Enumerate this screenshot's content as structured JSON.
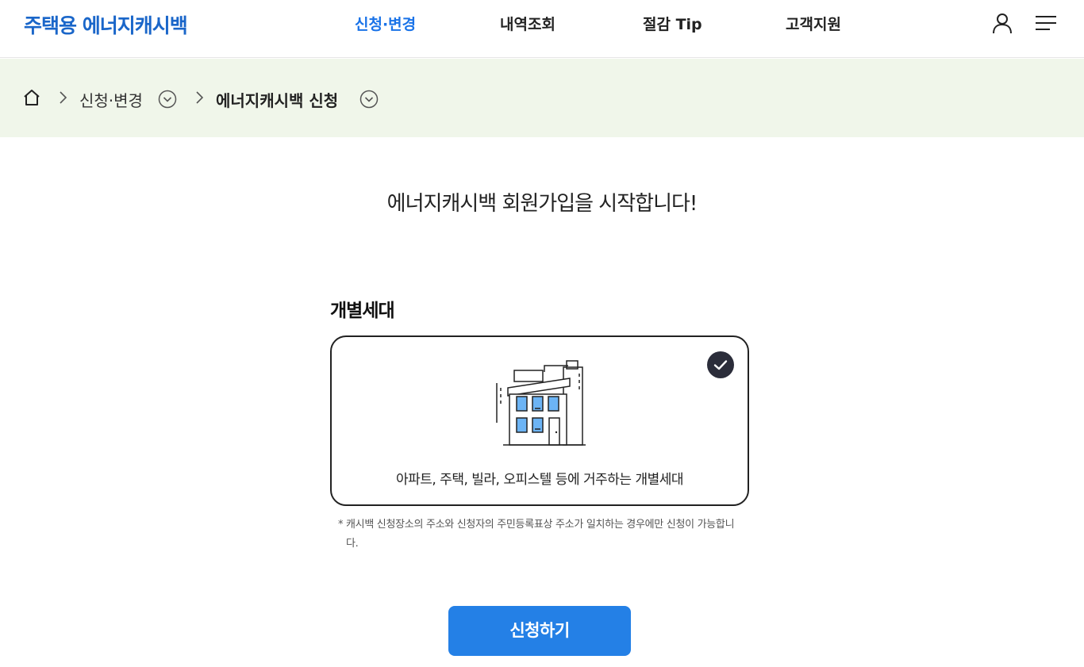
{
  "header": {
    "logo": "주택용 에너지캐시백",
    "nav": [
      {
        "label": "신청·변경",
        "active": true
      },
      {
        "label": "내역조회",
        "active": false
      },
      {
        "label": "절감 Tip",
        "active": false
      },
      {
        "label": "고객지원",
        "active": false
      }
    ],
    "icons": {
      "user": "user-icon",
      "menu": "hamburger-menu-icon"
    },
    "accent_color": "#1a73e8",
    "logo_color": "#1a66c9"
  },
  "breadcrumb": {
    "home_icon": "home-icon",
    "items": [
      {
        "label": "신청·변경"
      },
      {
        "label": "에너지캐시백 신청"
      }
    ],
    "background": "#f0f6ea"
  },
  "main": {
    "title": "에너지캐시백 회원가입을 시작합니다!",
    "section_label": "개별세대",
    "option": {
      "selected": true,
      "icon": "apartment-building-icon",
      "description": "아파트, 주택, 빌라, 오피스텔 등에 거주하는 개별세대"
    },
    "note_marker": "*",
    "note": "캐시백 신청장소의 주소와 신청자의 주민등록표상 주소가 일치하는 경우에만 신청이 가능합니다.",
    "submit_label": "신청하기",
    "submit_color": "#2480e6"
  }
}
